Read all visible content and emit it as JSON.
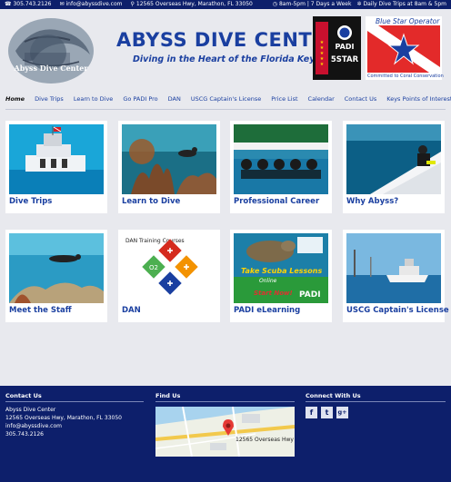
{
  "topbar": {
    "phone": "305.743.2126",
    "email": "info@abyssdive.com",
    "address": "12565 Overseas Hwy, Marathon, FL 33050",
    "hours": "8am-5pm | 7 Days a Week",
    "daily_trips": "Daily Dive Trips at 8am & 5pm"
  },
  "header": {
    "title": "ABYSS DIVE CENTER",
    "subtitle": "Diving in the Heart of the Florida Keys",
    "logo_text": "Abyss Dive Center",
    "padi_badge": "PADI",
    "padi_rating": "5STAR",
    "bso_title": "Blue Star Operator",
    "bso_caption": "Committed to Coral Conservation"
  },
  "nav": {
    "items": [
      {
        "label": "Home"
      },
      {
        "label": "Dive Trips"
      },
      {
        "label": "Learn to Dive"
      },
      {
        "label": "Go PADI Pro"
      },
      {
        "label": "DAN"
      },
      {
        "label": "USCG Captain's License"
      },
      {
        "label": "Price List"
      },
      {
        "label": "Calendar"
      },
      {
        "label": "Contact Us"
      },
      {
        "label": "Keys Points of Interest"
      }
    ]
  },
  "tiles": [
    {
      "label": "Dive Trips"
    },
    {
      "label": "Learn to Dive"
    },
    {
      "label": "Professional Career"
    },
    {
      "label": "Why Abyss?"
    },
    {
      "label": "Meet the Staff"
    },
    {
      "label": "DAN"
    },
    {
      "label": "PADI eLearning"
    },
    {
      "label": "USCG Captain's License"
    }
  ],
  "dan_tile": {
    "text": "DAN Training Courses"
  },
  "elearn_tile": {
    "line1": "Take Scuba Lessons",
    "line2": "Online",
    "line3": "Start Now!",
    "brand": "PADI"
  },
  "footer": {
    "contact_title": "Contact Us",
    "find_title": "Find Us",
    "connect_title": "Connect With Us",
    "company": "Abyss Dive Center",
    "address": "12565 Overseas Hwy, Marathon, FL 33050",
    "email": "info@abyssdive.com",
    "phone": "305.743.2126",
    "map_pin_label": "12565 Overseas Hwy",
    "social": [
      "f",
      "t",
      "g+"
    ]
  },
  "colors": {
    "brand_blue": "#1a3fa0",
    "navy": "#0d1f6b",
    "page_bg": "#e8e9ee"
  }
}
